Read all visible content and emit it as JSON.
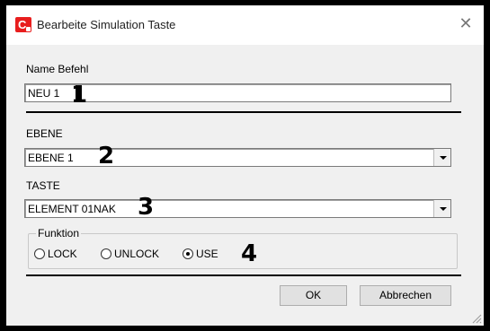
{
  "window": {
    "title": "Bearbeite Simulation Taste",
    "close_glyph": "✕"
  },
  "name_section": {
    "label": "Name Befehl",
    "value": "NEU 1",
    "marker": "1"
  },
  "ebene_section": {
    "label": "EBENE",
    "value": "EBENE 1",
    "marker": "2"
  },
  "taste_section": {
    "label": "TASTE",
    "value": "ELEMENT 01NAK",
    "marker": "3"
  },
  "funktion": {
    "label": "Funktion",
    "options": [
      {
        "label": "LOCK",
        "selected": false
      },
      {
        "label": "UNLOCK",
        "selected": false
      },
      {
        "label": "USE",
        "selected": true
      }
    ],
    "marker": "4"
  },
  "buttons": {
    "ok": "OK",
    "cancel": "Abbrechen"
  },
  "icons": {
    "app": "app-logo-icon",
    "close": "close-icon",
    "dropdown": "chevron-down-icon",
    "resize": "resize-grip-icon"
  },
  "colors": {
    "app_icon": "#e81e1e",
    "dialog_bg": "#f0f0f0",
    "outer_bg": "#000000"
  }
}
